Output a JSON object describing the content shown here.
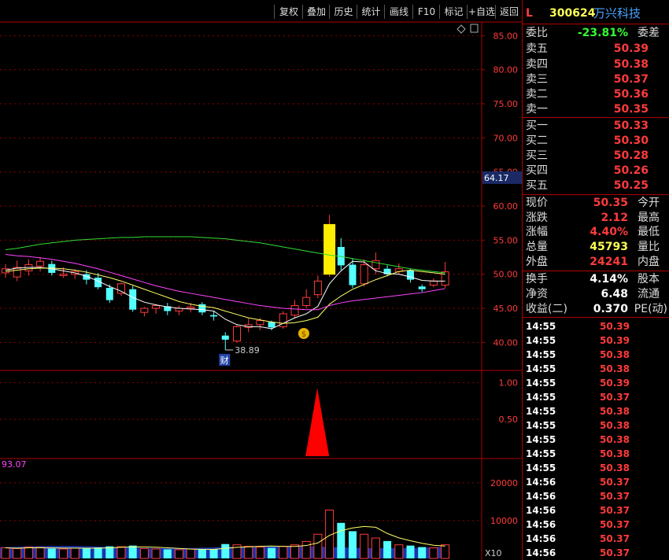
{
  "toolbar": [
    "复权",
    "叠加",
    "历史",
    "统计",
    "画线",
    "F10",
    "标记",
    "+自选",
    "返回"
  ],
  "header": {
    "flag": "L",
    "code": "300624",
    "name": "万兴科技"
  },
  "price_axis": [
    "85.00",
    "80.00",
    "75.00",
    "70.00",
    "65.00",
    "60.00",
    "55.00",
    "50.00",
    "45.00",
    "40.00"
  ],
  "price_tag": "64.17",
  "low_marker": {
    "label": "38.89",
    "icon": "财"
  },
  "signal_axis": [
    "1.00",
    "0.50"
  ],
  "volume_axis": [
    "20000",
    "10000"
  ],
  "volume_readout": "93.07",
  "volume_unit": "X10",
  "colors": {
    "up": "#ff3b3b",
    "down": "#54ffff",
    "ma5": "#ffffff",
    "ma10": "#ffff66",
    "ma20": "#ff44ff",
    "ma60": "#33dd33",
    "grid": "#8b0000"
  },
  "chart_data": {
    "type": "candlestick",
    "ylim": [
      36,
      87
    ],
    "candles": [
      {
        "o": 50.2,
        "h": 51.5,
        "l": 49.5,
        "c": 50.8
      },
      {
        "o": 49.6,
        "h": 52.0,
        "l": 49.0,
        "c": 51.0
      },
      {
        "o": 50.5,
        "h": 52.2,
        "l": 49.8,
        "c": 51.4
      },
      {
        "o": 51.2,
        "h": 52.5,
        "l": 50.4,
        "c": 51.9
      },
      {
        "o": 51.5,
        "h": 52.0,
        "l": 49.8,
        "c": 50.2
      },
      {
        "o": 49.8,
        "h": 51.0,
        "l": 49.5,
        "c": 50.0
      },
      {
        "o": 50.0,
        "h": 50.6,
        "l": 49.3,
        "c": 50.4
      },
      {
        "o": 50.0,
        "h": 50.6,
        "l": 48.5,
        "c": 49.2
      },
      {
        "o": 49.5,
        "h": 50.2,
        "l": 47.8,
        "c": 48.1
      },
      {
        "o": 48.0,
        "h": 48.5,
        "l": 45.8,
        "c": 46.2
      },
      {
        "o": 47.2,
        "h": 48.8,
        "l": 46.8,
        "c": 48.6
      },
      {
        "o": 47.8,
        "h": 48.3,
        "l": 44.5,
        "c": 44.8
      },
      {
        "o": 44.4,
        "h": 45.2,
        "l": 43.8,
        "c": 45.0
      },
      {
        "o": 45.0,
        "h": 45.6,
        "l": 44.2,
        "c": 45.4
      },
      {
        "o": 45.3,
        "h": 45.8,
        "l": 44.0,
        "c": 44.6
      },
      {
        "o": 44.6,
        "h": 45.4,
        "l": 44.0,
        "c": 45.0
      },
      {
        "o": 45.0,
        "h": 45.8,
        "l": 44.4,
        "c": 45.2
      },
      {
        "o": 45.6,
        "h": 45.9,
        "l": 44.0,
        "c": 44.4
      },
      {
        "o": 44.0,
        "h": 44.6,
        "l": 43.2,
        "c": 43.8
      },
      {
        "o": 41.0,
        "h": 41.5,
        "l": 38.89,
        "c": 40.4
      },
      {
        "o": 40.2,
        "h": 42.6,
        "l": 40.0,
        "c": 42.3
      },
      {
        "o": 42.2,
        "h": 43.5,
        "l": 41.5,
        "c": 42.6
      },
      {
        "o": 42.6,
        "h": 43.6,
        "l": 41.8,
        "c": 43.2
      },
      {
        "o": 43.0,
        "h": 43.2,
        "l": 41.8,
        "c": 42.2
      },
      {
        "o": 42.3,
        "h": 44.6,
        "l": 42.0,
        "c": 44.2
      },
      {
        "o": 44.0,
        "h": 46.2,
        "l": 43.5,
        "c": 45.4
      },
      {
        "o": 45.4,
        "h": 47.8,
        "l": 45.0,
        "c": 46.6
      },
      {
        "o": 47.0,
        "h": 49.8,
        "l": 46.5,
        "c": 49.0
      },
      {
        "o": 50.0,
        "h": 58.7,
        "l": 49.6,
        "c": 57.3
      },
      {
        "o": 54.0,
        "h": 55.3,
        "l": 50.6,
        "c": 51.3
      },
      {
        "o": 51.4,
        "h": 52.3,
        "l": 48.0,
        "c": 48.4
      },
      {
        "o": 48.6,
        "h": 52.2,
        "l": 48.2,
        "c": 51.4
      },
      {
        "o": 50.8,
        "h": 53.2,
        "l": 50.0,
        "c": 52.0
      },
      {
        "o": 50.8,
        "h": 51.3,
        "l": 49.7,
        "c": 50.0
      },
      {
        "o": 50.4,
        "h": 51.6,
        "l": 50.0,
        "c": 50.8
      },
      {
        "o": 50.6,
        "h": 50.8,
        "l": 48.8,
        "c": 49.2
      },
      {
        "o": 48.2,
        "h": 48.5,
        "l": 47.4,
        "c": 47.8
      },
      {
        "o": 48.4,
        "h": 49.4,
        "l": 48.1,
        "c": 49.0
      },
      {
        "o": 48.4,
        "h": 51.8,
        "l": 48.0,
        "c": 50.35
      }
    ],
    "ma": {
      "MA5": [
        50.6,
        50.9,
        51.0,
        51.0,
        50.8,
        50.5,
        50.2,
        49.7,
        49.0,
        48.2,
        47.5,
        46.6,
        45.9,
        45.5,
        45.2,
        45.0,
        44.9,
        44.8,
        44.6,
        43.4,
        42.6,
        42.3,
        42.3,
        42.0,
        42.8,
        43.6,
        44.2,
        45.3,
        48.6,
        50.5,
        51.9,
        51.8,
        50.5,
        50.1,
        50.0,
        49.6,
        49.1,
        49.0,
        49.0
      ],
      "MA10": [
        50.4,
        50.6,
        50.8,
        50.9,
        50.9,
        50.8,
        50.6,
        50.3,
        49.9,
        49.5,
        49.0,
        48.4,
        47.8,
        47.2,
        46.6,
        46.0,
        45.6,
        45.3,
        45.1,
        44.6,
        44.1,
        43.6,
        43.3,
        43.0,
        42.8,
        42.9,
        43.2,
        43.7,
        45.6,
        46.8,
        47.8,
        48.5,
        49.2,
        49.8,
        50.4,
        50.6,
        50.4,
        50.2,
        50.0
      ],
      "MA20": [
        52.9,
        52.7,
        52.6,
        52.4,
        52.2,
        51.9,
        51.6,
        51.2,
        50.8,
        50.3,
        49.8,
        49.3,
        48.8,
        48.3,
        47.9,
        47.5,
        47.2,
        46.9,
        46.6,
        46.3,
        46.0,
        45.7,
        45.4,
        45.2,
        45.0,
        44.9,
        44.8,
        44.8,
        45.4,
        45.8,
        46.1,
        46.3,
        46.5,
        46.7,
        46.9,
        47.1,
        47.3,
        47.6,
        47.9
      ],
      "MA60": [
        53.6,
        53.8,
        54.1,
        54.4,
        54.6,
        54.8,
        55.0,
        55.1,
        55.2,
        55.3,
        55.4,
        55.4,
        55.5,
        55.5,
        55.5,
        55.5,
        55.5,
        55.4,
        55.3,
        55.2,
        55.0,
        54.8,
        54.6,
        54.3,
        54.0,
        53.7,
        53.4,
        53.1,
        52.8,
        52.6,
        52.3,
        52.0,
        51.7,
        51.4,
        51.1,
        50.8,
        50.6,
        50.4,
        50.2
      ]
    },
    "signal": {
      "index": 27,
      "value": 1.0,
      "ylim": [
        0,
        1.1
      ]
    },
    "volume": {
      "ylim": [
        0,
        26000
      ],
      "values": [
        2800,
        2600,
        3000,
        2900,
        2600,
        2500,
        2700,
        2800,
        2900,
        3200,
        3100,
        3400,
        2600,
        2500,
        2400,
        2300,
        2500,
        2400,
        2400,
        3800,
        3600,
        3200,
        3000,
        2800,
        3200,
        3600,
        4500,
        6400,
        12800,
        9400,
        7200,
        6400,
        5400,
        4600,
        3600,
        3400,
        3000,
        2800,
        3600
      ]
    }
  }
}
